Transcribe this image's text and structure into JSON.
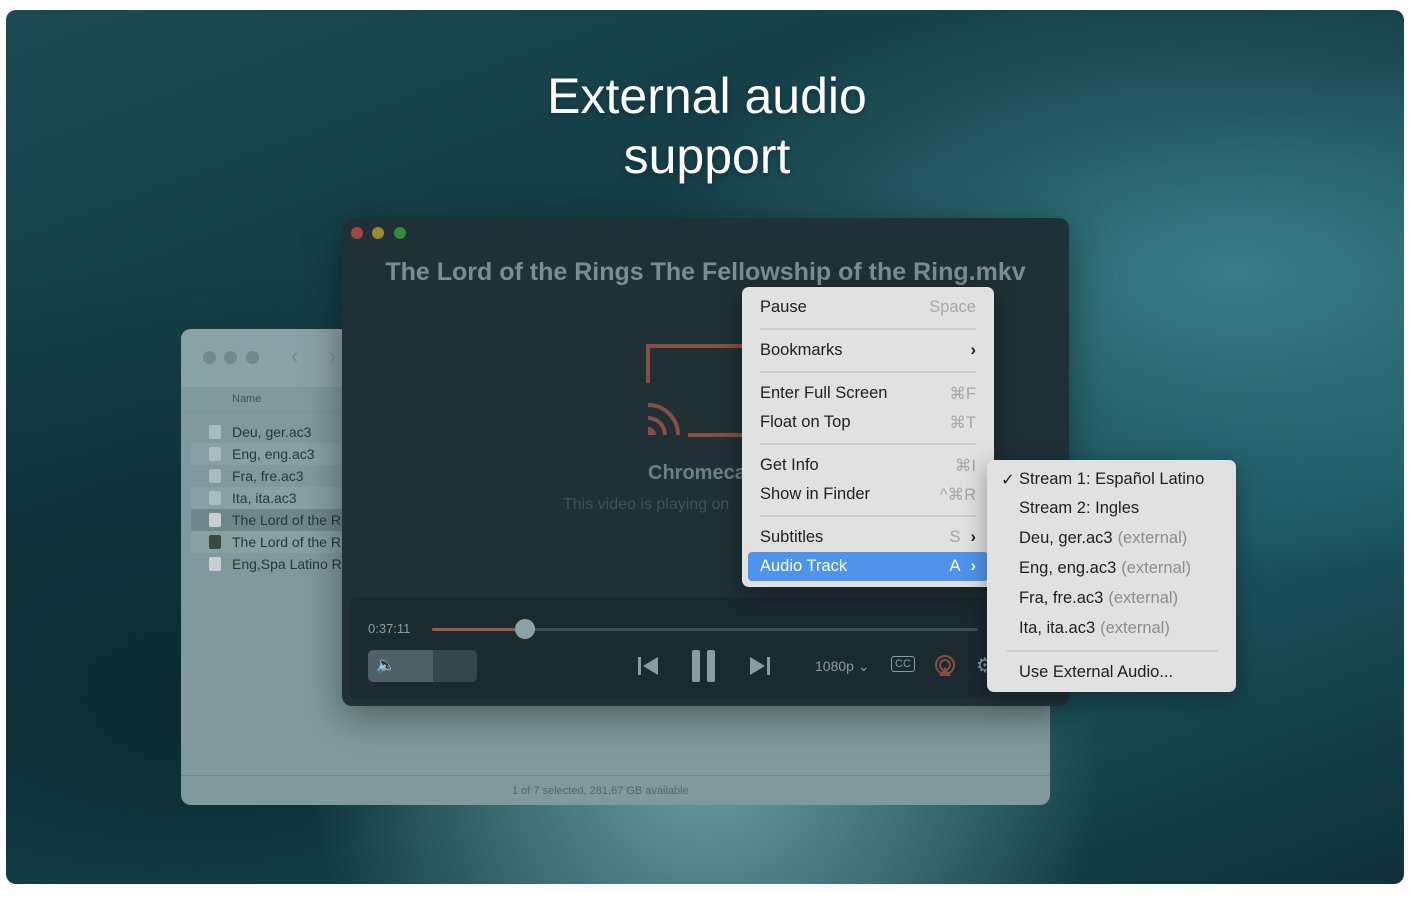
{
  "headline": {
    "line1": "External audio",
    "line2": "support"
  },
  "finder": {
    "column_header": "Name",
    "files": [
      {
        "name": "Deu, ger.ac3",
        "type": "audio"
      },
      {
        "name": "Eng, eng.ac3",
        "type": "audio"
      },
      {
        "name": "Fra, fre.ac3",
        "type": "audio"
      },
      {
        "name": "Ita, ita.ac3",
        "type": "audio"
      },
      {
        "name": "The Lord of the R",
        "type": "video",
        "selected": true
      },
      {
        "name": "The Lord of the R",
        "type": "poster"
      },
      {
        "name": "Eng,Spa Latino R",
        "type": "video"
      }
    ],
    "status": "1 of 7 selected, 281,67 GB available"
  },
  "player": {
    "title": "The Lord of the Rings The Fellowship of the Ring.mkv",
    "cast_name": "Chromeca",
    "cast_sub": "This video is playing on",
    "time": "0:37:11",
    "progress_percent": 17,
    "volume_percent": 60,
    "quality": "1080p",
    "cc_label": "CC",
    "accent": "#9a5a48"
  },
  "context_menu": {
    "items": [
      {
        "label": "Pause",
        "shortcut": "Space"
      },
      {
        "label": "Bookmarks",
        "submenu": true
      },
      {
        "label": "Enter Full Screen",
        "shortcut": "⌘F"
      },
      {
        "label": "Float on Top",
        "shortcut": "⌘T"
      },
      {
        "label": "Get Info",
        "shortcut": "⌘I"
      },
      {
        "label": "Show in Finder",
        "shortcut": "^⌘R"
      },
      {
        "label": "Subtitles",
        "shortcut": "S",
        "submenu": true
      },
      {
        "label": "Audio Track",
        "shortcut": "A",
        "submenu": true,
        "highlighted": true
      }
    ],
    "highlight_color": "#4f94ea"
  },
  "audio_submenu": {
    "items": [
      {
        "label": "Stream 1: Español Latino",
        "checked": true
      },
      {
        "label": "Stream 2: Ingles"
      },
      {
        "label": "Deu, ger.ac3",
        "suffix": "(external)"
      },
      {
        "label": "Eng, eng.ac3",
        "suffix": "(external)"
      },
      {
        "label": "Fra, fre.ac3",
        "suffix": "(external)"
      },
      {
        "label": "Ita, ita.ac3",
        "suffix": "(external)"
      }
    ],
    "footer": "Use External Audio...",
    "check": "✓"
  }
}
